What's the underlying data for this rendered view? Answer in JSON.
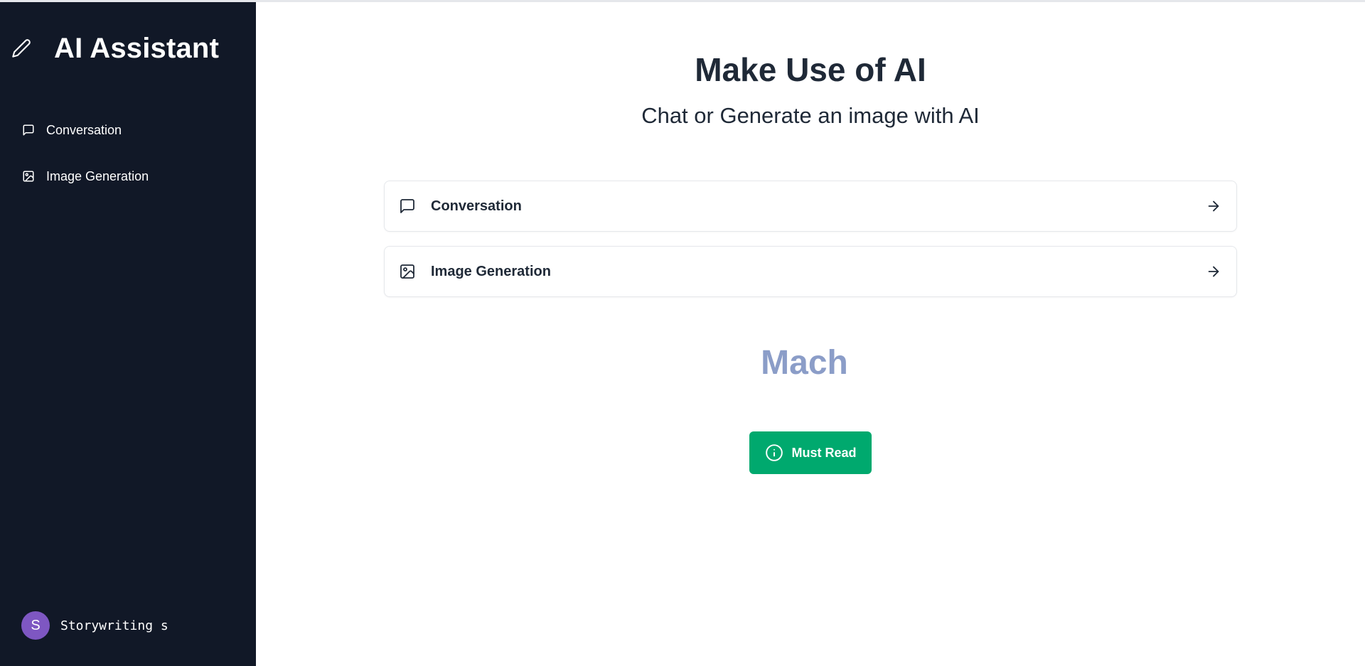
{
  "app": {
    "title": "AI Assistant",
    "brand_icon": "pencil-icon"
  },
  "sidebar": {
    "items": [
      {
        "label": "Conversation",
        "icon": "chat-bubble-icon"
      },
      {
        "label": "Image Generation",
        "icon": "image-icon"
      }
    ],
    "user": {
      "initial": "S",
      "name": "Storywriting s",
      "avatar_color": "#7e57c2"
    },
    "background_color": "#111827"
  },
  "main": {
    "heading": "Make Use of AI",
    "subheading": "Chat or Generate an image with AI",
    "cards": [
      {
        "label": "Conversation",
        "icon": "chat-bubble-icon",
        "action_icon": "arrow-right-icon"
      },
      {
        "label": "Image Generation",
        "icon": "image-icon",
        "action_icon": "arrow-right-icon"
      }
    ],
    "brand_text": "Mach",
    "brand_text_color": "#8b9dc8",
    "must_read": {
      "label": "Must Read",
      "icon": "info-icon",
      "color": "#00a96e"
    }
  }
}
